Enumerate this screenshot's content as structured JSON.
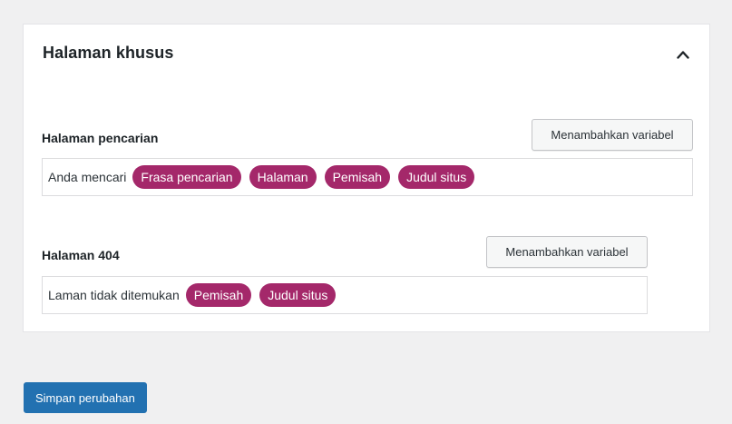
{
  "card": {
    "title": "Halaman khusus",
    "collapse_icon": "chevron-up-icon"
  },
  "search_page": {
    "label": "Halaman pencarian",
    "add_variable_label": "Menambahkan variabel",
    "prefix_text": "Anda mencari",
    "variables": [
      "Frasa pencarian",
      "Halaman",
      "Pemisah",
      "Judul situs"
    ]
  },
  "not_found_page": {
    "label": "Halaman 404",
    "add_variable_label": "Menambahkan variabel",
    "prefix_text": "Laman tidak ditemukan",
    "variables": [
      "Pemisah",
      "Judul situs"
    ]
  },
  "footer": {
    "save_label": "Simpan perubahan"
  },
  "colors": {
    "pill": "#a4286a",
    "primary_button": "#2271b1",
    "background": "#f0f0f1"
  }
}
